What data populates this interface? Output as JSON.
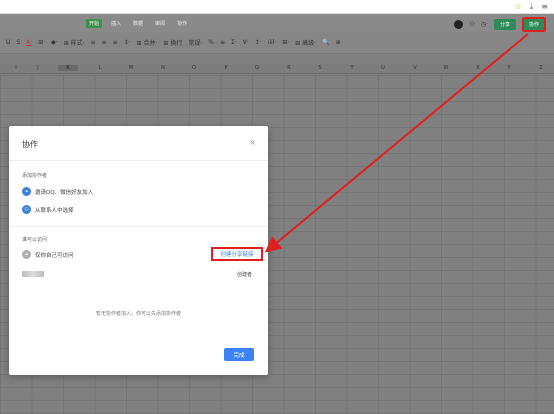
{
  "browser": {
    "icons": [
      "star-icon",
      "download-icon",
      "menu-icon"
    ],
    "glyphs": [
      "☆",
      "⤓",
      "≡"
    ]
  },
  "menubar": {
    "tabs": [
      {
        "label": "开始",
        "active": true
      },
      {
        "label": "插入",
        "active": false
      },
      {
        "label": "数据",
        "active": false
      },
      {
        "label": "审阅",
        "active": false
      },
      {
        "label": "协作",
        "active": false
      }
    ],
    "share_label": "分享",
    "collab_label": "协作"
  },
  "toolbar": {
    "items": [
      "U",
      "S",
      "A·",
      "⊞·",
      "◆·",
      "⊞ 样式·",
      "≡",
      "≡",
      "≡",
      "↕·",
      "⊞ 合并·",
      "⊞ 换行",
      "常规·",
      "%",
      "≡",
      "Σ·",
      "∀·",
      "↥·",
      "ılıl·",
      "⊞·",
      "⊞ 高级·",
      "🔍",
      "⊕"
    ]
  },
  "columns": [
    "I",
    "J",
    "K",
    "L",
    "M",
    "N",
    "O",
    "P",
    "Q",
    "R",
    "S",
    "T",
    "U",
    "V",
    "W",
    "X",
    "Y",
    "Z"
  ],
  "selected_column": "K",
  "dialog": {
    "title": "协作",
    "close_glyph": "×",
    "add_section_label": "添加协作者",
    "invite_option": "邀请QQ、微信好友加入",
    "contact_option": "从联系人中选择",
    "access_section_label": "谁可以访问",
    "access_text": "仅你自己可访问",
    "create_link_label": "创建分享链接",
    "creator_label": "创建者",
    "empty_note": "暂无协作者加入，你可以先添加协作者",
    "done_label": "完成"
  },
  "colors": {
    "accent": "#3b82d6",
    "highlight": "#e02020",
    "green": "#2e8b57"
  }
}
